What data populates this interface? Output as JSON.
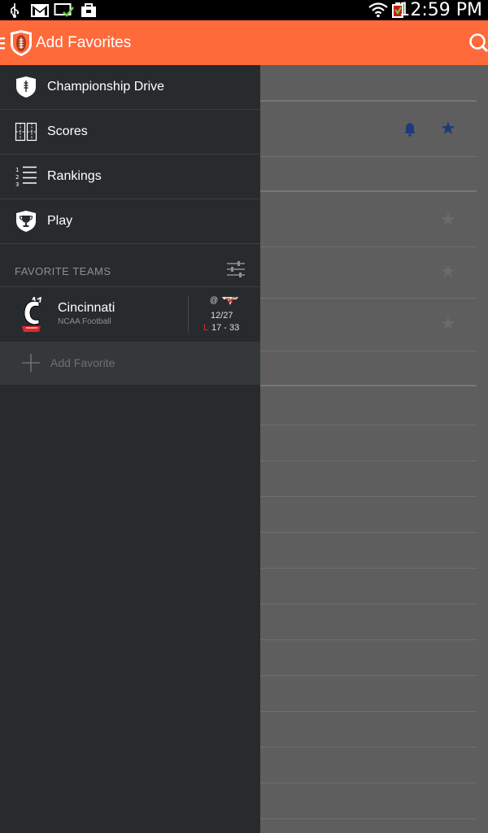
{
  "status_bar": {
    "time": "12:59 PM",
    "left_icons": [
      "usb-icon",
      "gmail-icon",
      "download-icon",
      "shopping-bag-icon"
    ],
    "right_icons": [
      "wifi-icon",
      "battery-icon"
    ]
  },
  "action_bar": {
    "title": "Add Favorites",
    "app_icon": "football-shield-icon",
    "menu_icon": "hamburger-icon",
    "search_icon": "search-icon",
    "color": "#ff6a3b"
  },
  "drawer": {
    "nav_items": [
      {
        "label": "Championship Drive",
        "icon": "shield-football-icon"
      },
      {
        "label": "Scores",
        "icon": "scoreboard-icon"
      },
      {
        "label": "Rankings",
        "icon": "ranked-list-icon"
      },
      {
        "label": "Play",
        "icon": "trophy-icon"
      }
    ],
    "section_title": "FAVORITE TEAMS",
    "favorites": [
      {
        "team": "Cincinnati",
        "league": "NCAA Football",
        "at": "@",
        "opponent_logo": "VT",
        "date": "12/27",
        "result": "L",
        "score": "17 - 33"
      }
    ],
    "add_favorite_label": "Add Favorite"
  },
  "background": {
    "icons": [
      "bell-icon",
      "star-icon"
    ],
    "star_filled_color": "#1d3a7a",
    "star_empty_color": "#6a6a6a"
  }
}
